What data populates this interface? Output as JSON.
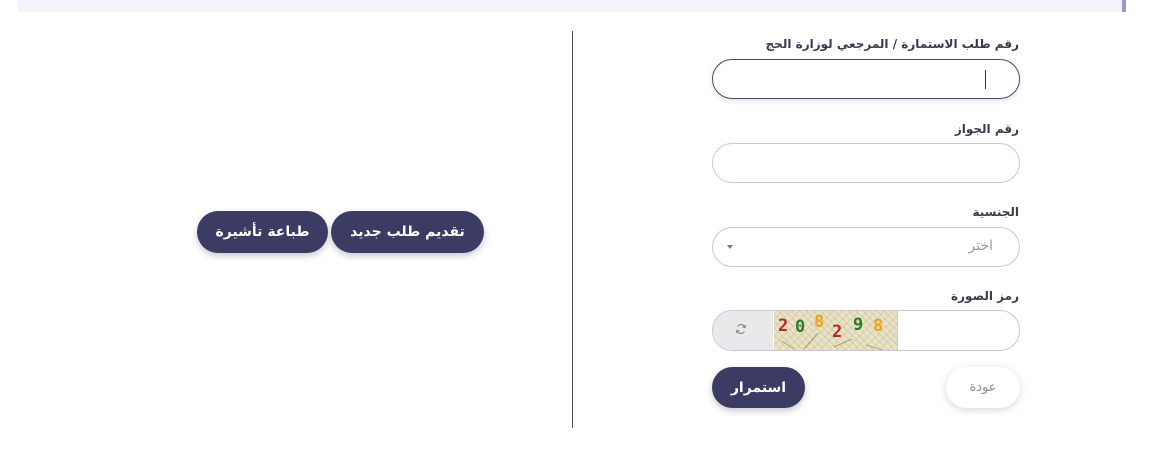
{
  "form": {
    "reference_label": "رقم طلب الاستمارة / المرجعي لوزارة الحج",
    "reference_value": "",
    "passport_label": "رقم الجواز",
    "passport_value": "",
    "nationality_label": "الجنسية",
    "nationality_selected": "اختر",
    "captcha_label": "رمز الصورة",
    "captcha_value": "",
    "captcha_digits": [
      "2",
      "0",
      "8",
      "2",
      "9",
      "8"
    ],
    "continue_label": "استمرار",
    "back_label": "عودة"
  },
  "actions": {
    "new_request_label": "تقديم طلب جديد",
    "print_visa_label": "طباعة تأشيرة"
  },
  "colors": {
    "primary": "#3c3b63",
    "captcha_red": "#b52a2a",
    "captcha_green": "#2c7a2a",
    "captcha_orange": "#f0a21a"
  },
  "icons": {
    "refresh": "refresh-icon",
    "dropdown": "chevron-down-icon"
  }
}
